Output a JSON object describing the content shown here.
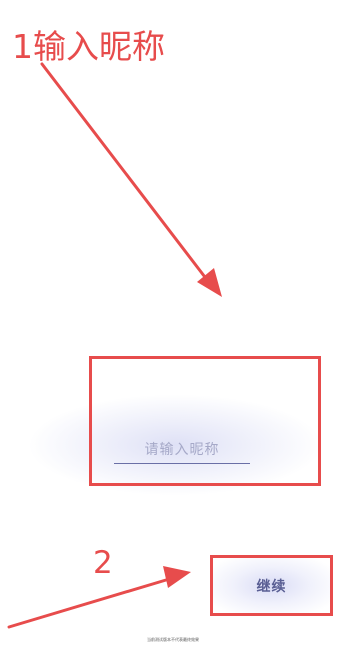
{
  "annotations": {
    "step1_label": "1输入昵称",
    "step2_label": "2",
    "color": "#e74c4c"
  },
  "nickname": {
    "placeholder": "请输入昵称",
    "value": ""
  },
  "continue_button": {
    "label": "继续"
  },
  "footer": {
    "note": "当前测试版本不代表最终效果"
  },
  "colors": {
    "accent_text": "#5a5f94",
    "underline": "#6a6fa6",
    "glow": "#c4c8ee"
  }
}
